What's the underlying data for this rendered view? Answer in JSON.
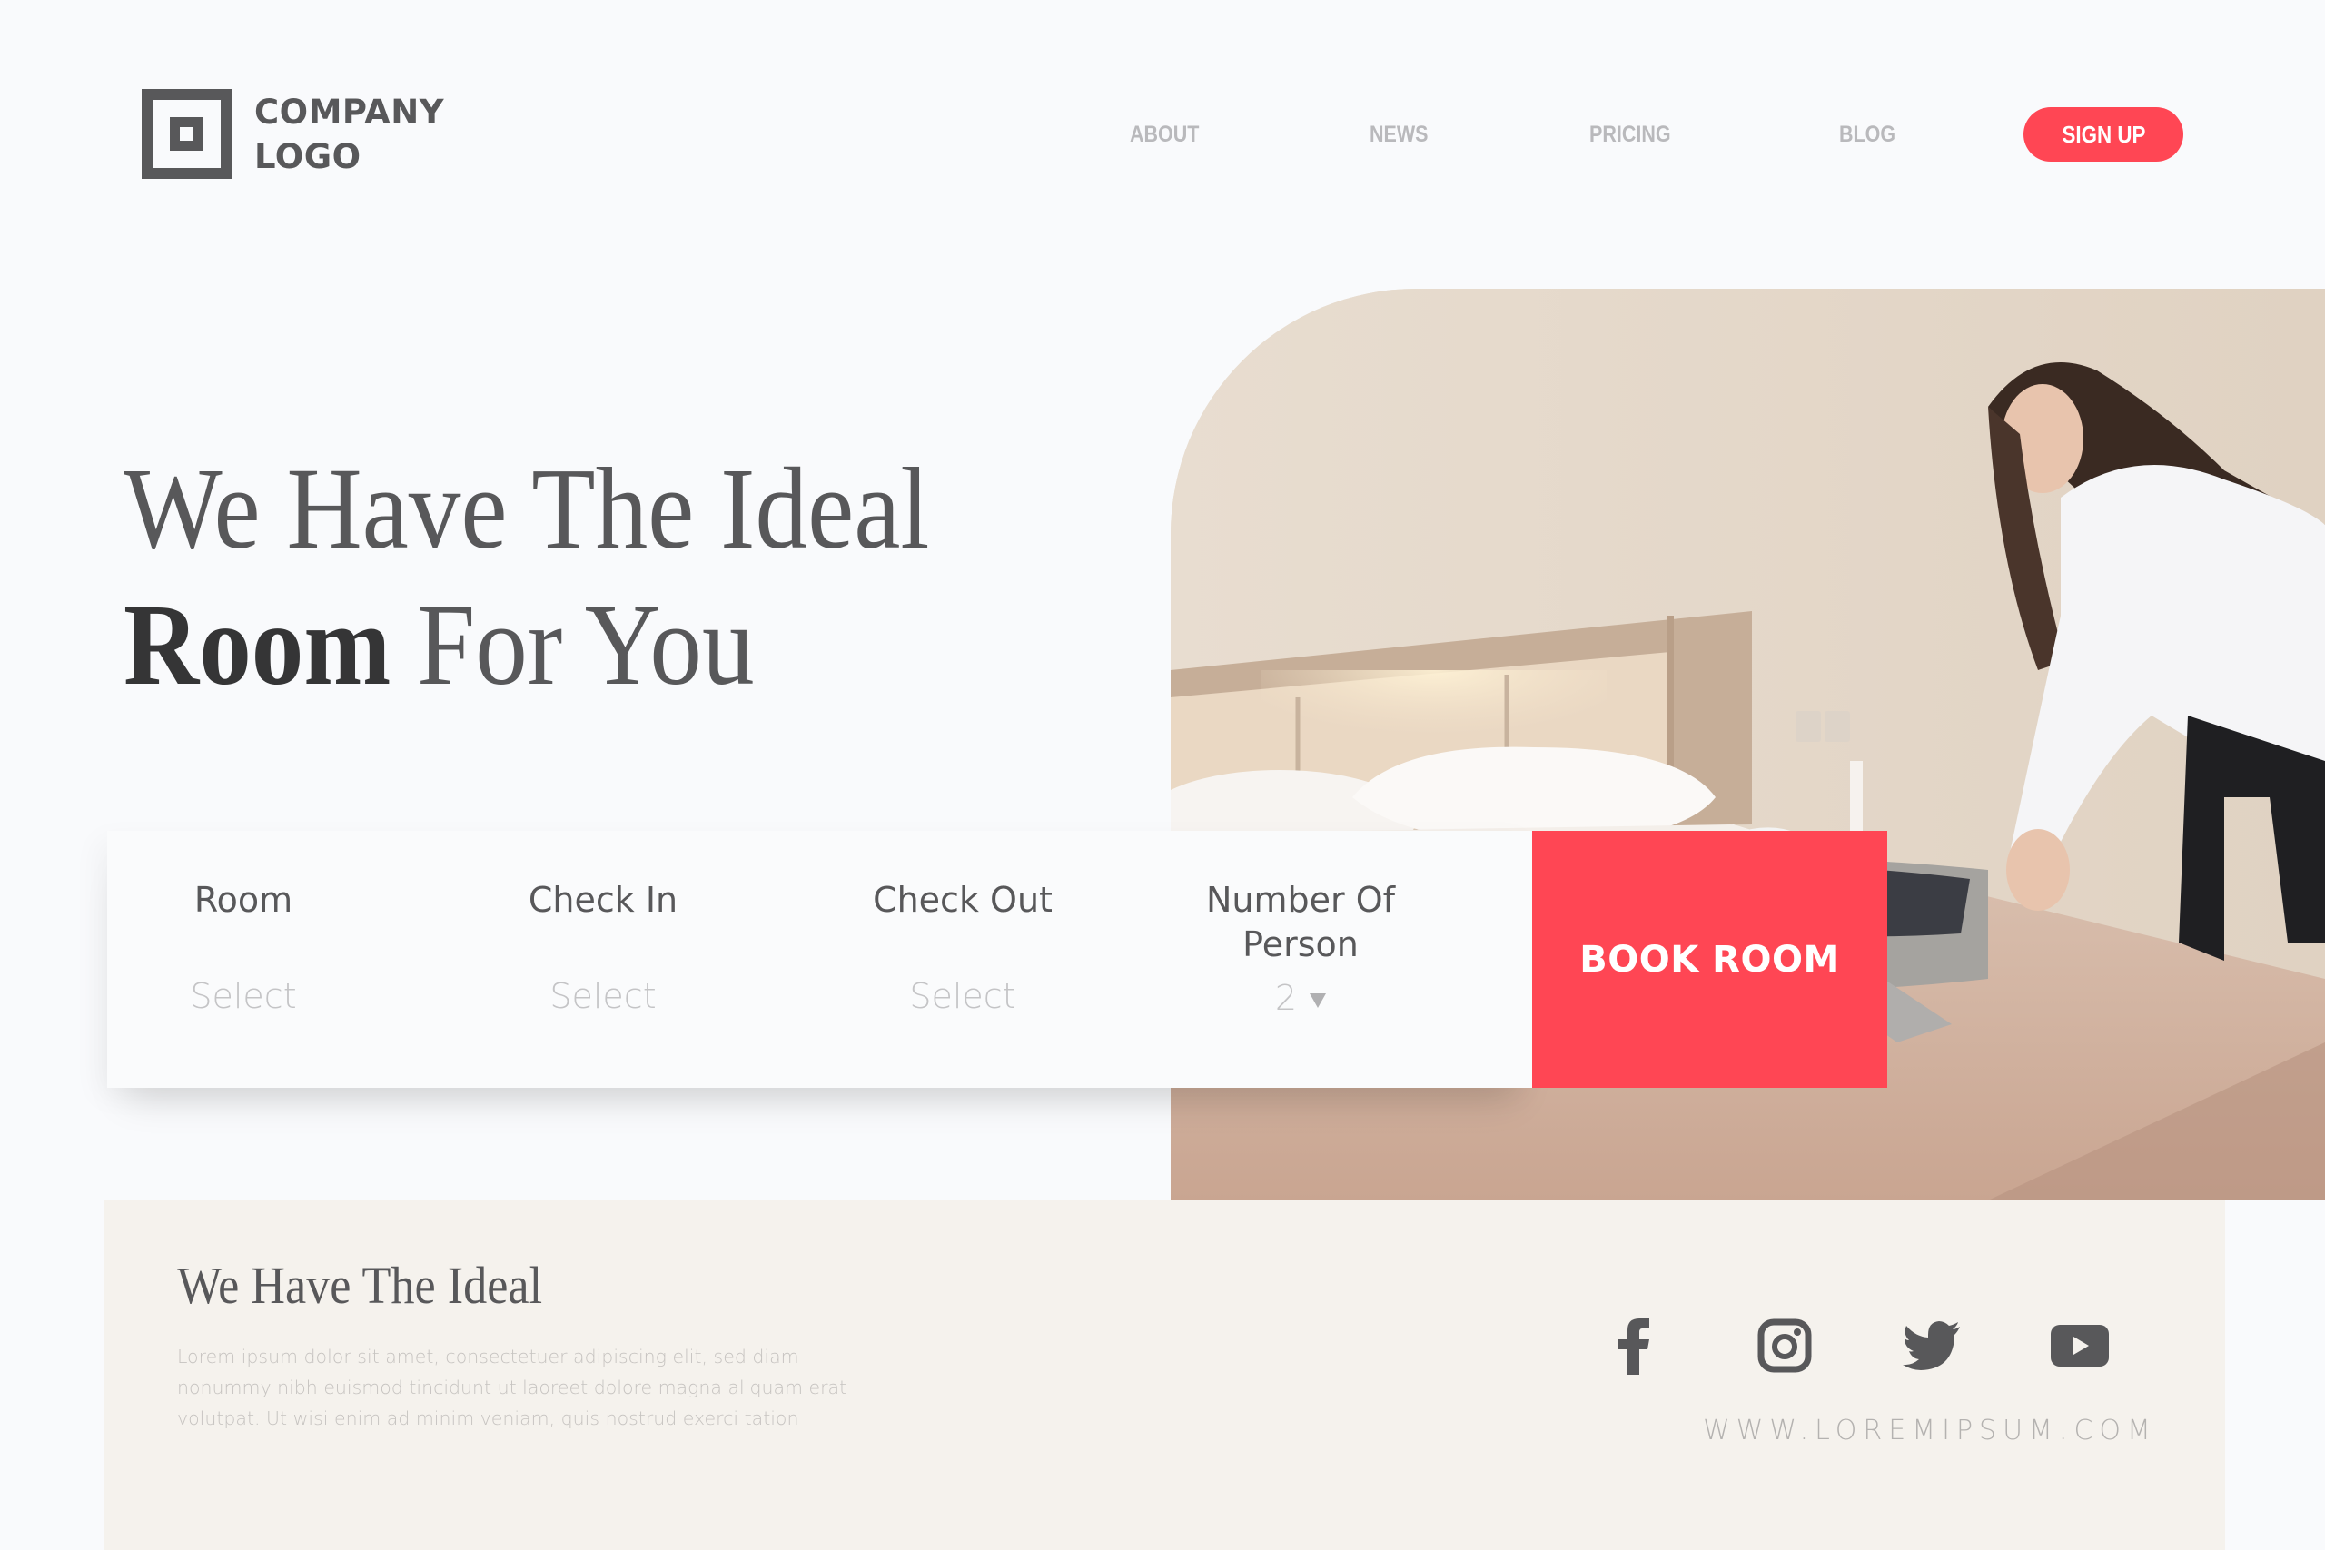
{
  "header": {
    "logo": {
      "line1": "COMPANY",
      "line2": "LOGO"
    },
    "nav": [
      {
        "label": "ABOUT"
      },
      {
        "label": "NEWS"
      },
      {
        "label": "PRICING"
      },
      {
        "label": "BLOG"
      }
    ],
    "signup_label": "SIGN UP"
  },
  "hero": {
    "title_line1": "We Have The Ideal",
    "title_bold": "Room",
    "title_rest": " For You",
    "image_alt": "Woman packing a suitcase on a hotel bed"
  },
  "booking": {
    "fields": [
      {
        "label": "Room",
        "value": "Select"
      },
      {
        "label": "Check In",
        "value": "Select"
      },
      {
        "label": "Check Out",
        "value": "Select"
      },
      {
        "label": "Number Of Person",
        "value": "2"
      }
    ],
    "book_label": "BOOK ROOM"
  },
  "footer": {
    "title": "We Have The Ideal",
    "body": "Lorem ipsum dolor sit amet, consectetuer adipiscing elit, sed diam nonummy nibh euismod tincidunt ut laoreet dolore magna aliquam erat volutpat. Ut wisi enim ad minim veniam, quis nostrud exerci tation",
    "socials": [
      {
        "name": "facebook",
        "icon": "facebook-icon"
      },
      {
        "name": "instagram",
        "icon": "instagram-icon"
      },
      {
        "name": "twitter",
        "icon": "twitter-icon"
      },
      {
        "name": "youtube",
        "icon": "youtube-icon"
      }
    ],
    "url": "WWW.LOREMIPSUM.COM"
  },
  "colors": {
    "accent": "#ff4654",
    "text_dark": "#58585a",
    "footer_bg": "#f5f2ed",
    "page_bg": "#f9fafc"
  }
}
